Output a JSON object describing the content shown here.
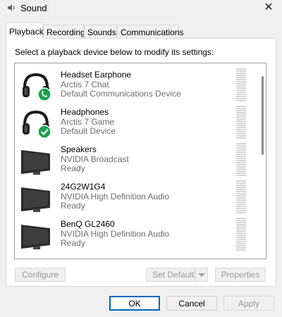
{
  "window": {
    "title": "Sound",
    "close_glyph": "✕"
  },
  "tabs": [
    {
      "label": "Playback",
      "active": true
    },
    {
      "label": "Recording",
      "active": false
    },
    {
      "label": "Sounds",
      "active": false
    },
    {
      "label": "Communications",
      "active": false
    }
  ],
  "panel": {
    "instruction": "Select a playback device below to modify its settings:"
  },
  "devices": [
    {
      "name": "Headset Earphone",
      "line1": "Arctis 7 Chat",
      "line2": "Default Communications Device",
      "icon": "headset-icon",
      "badge": "phone-badge-icon"
    },
    {
      "name": "Headphones",
      "line1": "Arctis 7 Game",
      "line2": "Default Device",
      "icon": "headset-icon",
      "badge": "checkmark-badge-icon"
    },
    {
      "name": "Speakers",
      "line1": "NVIDIA Broadcast",
      "line2": "Ready",
      "icon": "monitor-icon",
      "badge": ""
    },
    {
      "name": "24G2W1G4",
      "line1": "NVIDIA High Definition Audio",
      "line2": "Ready",
      "icon": "monitor-icon",
      "badge": ""
    },
    {
      "name": "BenQ GL2460",
      "line1": "NVIDIA High Definition Audio",
      "line2": "Ready",
      "icon": "monitor-icon",
      "badge": ""
    }
  ],
  "buttons": {
    "configure": "Configure",
    "set_default": "Set Default",
    "properties": "Properties",
    "ok": "OK",
    "cancel": "Cancel",
    "apply": "Apply"
  },
  "colors": {
    "accent": "#0067c0",
    "badge_green": "#16a34a"
  }
}
